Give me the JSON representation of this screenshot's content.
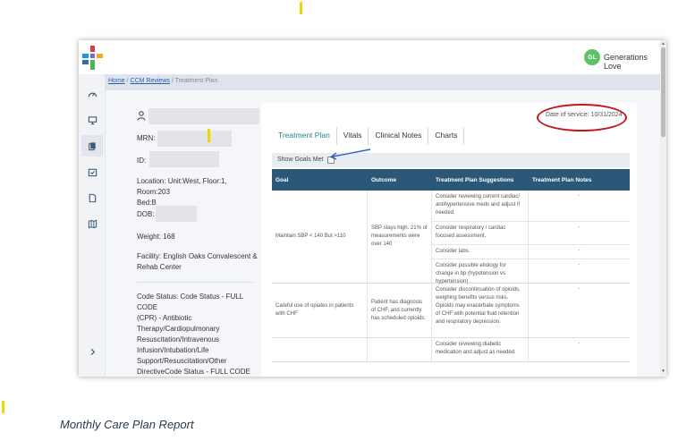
{
  "app": {
    "user_initials": "GL",
    "user_name": "Generations Love"
  },
  "breadcrumb": {
    "home": "Home",
    "sep1": "/",
    "ccm_reviews": "CCM Reviews",
    "sep2": "/",
    "current": "Treatment Plan"
  },
  "sidenav": {
    "icons": [
      "dashboard-icon",
      "monitor-icon",
      "copy-icon",
      "calendar-check-icon",
      "document-icon",
      "book-icon",
      "chevron-right-icon"
    ]
  },
  "patient": {
    "mrn_label": "MRN:",
    "id_label": "ID:",
    "location_label": "Location:",
    "location_line1": "Unit:West, Floor:1, Room:203",
    "location_line2": "Bed:B",
    "dob_label": "DOB:",
    "weight_label": "Weight:",
    "weight_value": "168",
    "facility_label": "Facility:",
    "facility_line1": "English Oaks Convalescent &",
    "facility_line2": "Rehab Center",
    "code_status_label": "Code Status:",
    "code_status_lines": [
      "Code Status - FULL CODE",
      "(CPR) - Antibiotic",
      "Therapy/Cardiopulmonary",
      "Resuscitation/Intravenous",
      "Infusion/Intubation/Life",
      "Support/Resuscitation/Other",
      "DirectiveCode Status - FULL CODE (CPR)"
    ]
  },
  "tabs": [
    {
      "label": "Treatment Plan",
      "active": true
    },
    {
      "label": "Vitals",
      "active": false
    },
    {
      "label": "Clinical Notes",
      "active": false
    },
    {
      "label": "Charts",
      "active": false
    }
  ],
  "date_of_service": "Date of service: 10/31/2024",
  "show_goals": {
    "label": "Show Goals Met",
    "checked": false
  },
  "table": {
    "headers": [
      "Goal",
      "Outcome",
      "Treatment Plan Suggestions",
      "Treatment Plan Notes"
    ],
    "rows": [
      {
        "goal": "Maintain SBP < 140 But >110",
        "outcome": "SBP stays high. 21% of measurements were over 140",
        "suggestions": [
          "Consider reviewing current cardiac/ antihypertensive meds and adjust if needed.",
          "Consider respiratory / cardiac focused assessment.",
          "Consider labs.",
          "Consider possible etiology for change in bp (hypotension vs hypertension) ."
        ],
        "notes": [
          "-",
          "-",
          "-",
          "-"
        ]
      },
      {
        "goal": "Careful use of opiates in patients with CHF",
        "outcome": "Patient has diagnosis of CHF, and currently has scheduled opioids.",
        "suggestions": [
          "Consider discontinuation of opioids, weighing benefits versus risks. Opioids may exacerbate symptoms of CHF with potential fluid retention and respiratory depression."
        ],
        "notes": [
          "-"
        ]
      },
      {
        "goal": "",
        "outcome": "",
        "suggestions": [
          "Consider reviewing diabetic medication and adjust as needed."
        ],
        "notes": [
          "-"
        ]
      }
    ]
  },
  "caption": "Monthly Care Plan Report"
}
